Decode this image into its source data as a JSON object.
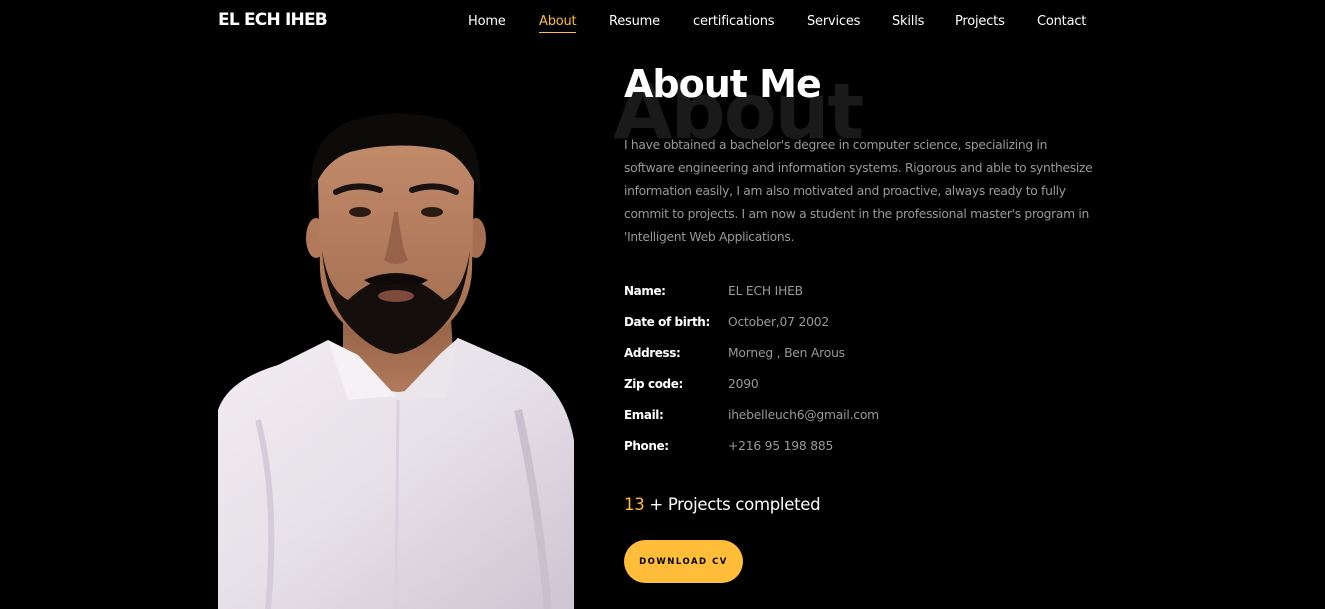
{
  "brand": "EL ECH IHEB",
  "nav": {
    "items": [
      {
        "label": "Home"
      },
      {
        "label": "About"
      },
      {
        "label": "Resume"
      },
      {
        "label": "certifications"
      },
      {
        "label": "Services"
      },
      {
        "label": "Skills"
      },
      {
        "label": "Projects"
      },
      {
        "label": "Contact"
      }
    ],
    "active": "About"
  },
  "about": {
    "ghost_heading": "About",
    "heading": "About Me",
    "bio": "I have obtained a bachelor's degree in computer science, specializing in software engineering and information systems. Rigorous and able to synthesize information easily, I am also motivated and proactive, always ready to fully commit to projects. I am now a student in the professional master's program in 'Intelligent Web Applications.",
    "info": [
      {
        "label": "Name:",
        "value": "EL ECH IHEB"
      },
      {
        "label": "Date of birth:",
        "value": "October,07 2002"
      },
      {
        "label": "Address:",
        "value": "Morneg , Ben Arous"
      },
      {
        "label": "Zip code:",
        "value": "2090"
      },
      {
        "label": "Email:",
        "value": "ihebelleuch6@gmail.com"
      },
      {
        "label": "Phone:",
        "value": "+216 95 198 885"
      }
    ],
    "counter": {
      "number": "13",
      "text": " + Projects completed"
    },
    "cv_button": "DOWNLOAD CV"
  },
  "colors": {
    "accent": "#ffbd39",
    "background": "#000000",
    "muted_text": "#999999"
  },
  "icons": {
    "photo": "profile-photo"
  }
}
